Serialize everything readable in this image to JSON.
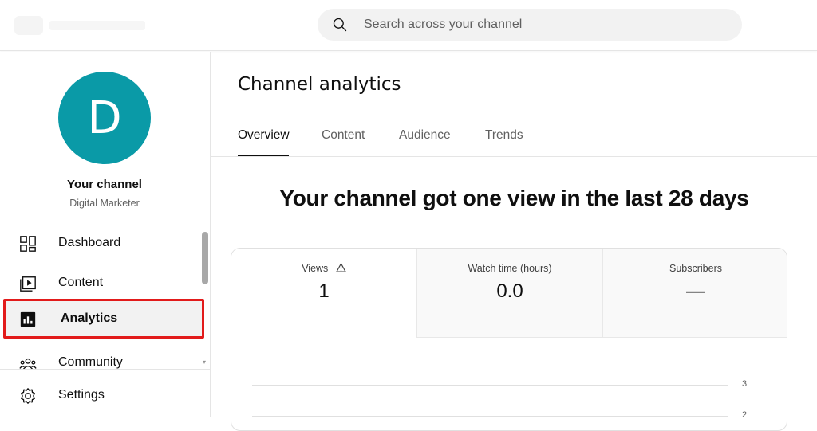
{
  "search": {
    "placeholder": "Search across your channel"
  },
  "channel": {
    "avatar_letter": "D",
    "name": "Your channel",
    "subtitle": "Digital Marketer",
    "avatar_color": "#0a9aa7"
  },
  "nav": {
    "items": [
      {
        "label": "Dashboard",
        "icon": "dashboard-icon"
      },
      {
        "label": "Content",
        "icon": "content-icon"
      },
      {
        "label": "Analytics",
        "icon": "analytics-icon",
        "active": true
      },
      {
        "label": "Community",
        "icon": "community-icon"
      },
      {
        "label": "Settings",
        "icon": "settings-icon"
      }
    ]
  },
  "page": {
    "title": "Channel analytics",
    "tabs": [
      {
        "label": "Overview",
        "active": true
      },
      {
        "label": "Content"
      },
      {
        "label": "Audience"
      },
      {
        "label": "Trends"
      }
    ],
    "headline": "Your channel got one view in the last 28 days"
  },
  "metrics": [
    {
      "label": "Views",
      "value": "1",
      "warning": true
    },
    {
      "label": "Watch time (hours)",
      "value": "0.0"
    },
    {
      "label": "Subscribers",
      "value": "—"
    }
  ],
  "chart": {
    "ytick_labels": [
      "3",
      "2"
    ]
  },
  "colors": {
    "highlight": "#e21b1b",
    "accent": "#0a9aa7"
  }
}
